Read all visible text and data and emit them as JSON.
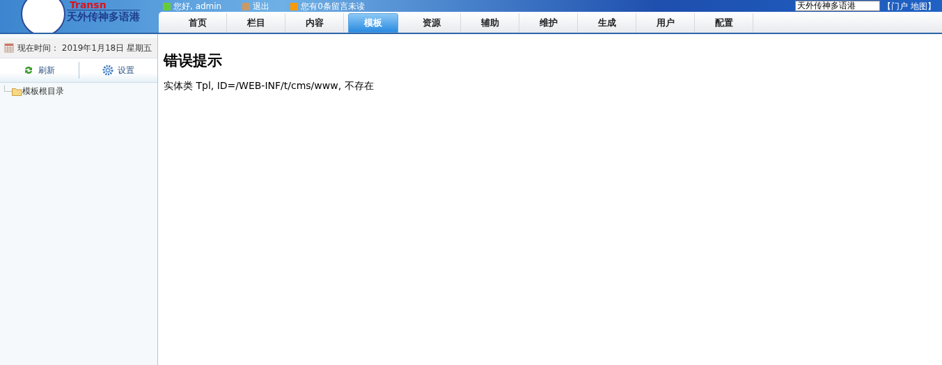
{
  "header": {
    "logo_text": "Transn",
    "logo_subtitle": "天外传神多语港",
    "greeting": "您好, admin",
    "logout": "退出",
    "messages": "您有0条留言未读",
    "search": {
      "value": "天外传神多语港"
    },
    "links": "【门户 地图】"
  },
  "tabs": [
    {
      "label": "首页",
      "selected": false
    },
    {
      "label": "栏目",
      "selected": false
    },
    {
      "label": "内容",
      "selected": false
    },
    {
      "label": "模板",
      "selected": true
    },
    {
      "label": "资源",
      "selected": false
    },
    {
      "label": "辅助",
      "selected": false
    },
    {
      "label": "维护",
      "selected": false
    },
    {
      "label": "生成",
      "selected": false
    },
    {
      "label": "用户",
      "selected": false
    },
    {
      "label": "配置",
      "selected": false
    }
  ],
  "sidebar": {
    "date": "现在时间： 2019年1月18日 星期五",
    "buttons": [
      {
        "kind": "refresh",
        "label": "刷新"
      },
      {
        "kind": "settings",
        "label": "设置"
      }
    ],
    "tree": [
      {
        "label": "模板根目录"
      }
    ]
  },
  "main": {
    "title": "错误提示",
    "message": "实体类 Tpl, ID=/WEB-INF/t/cms/www, 不存在"
  }
}
